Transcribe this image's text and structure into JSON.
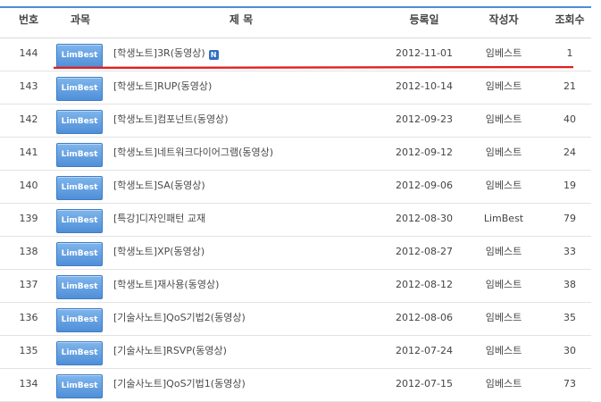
{
  "header": {
    "num": "번호",
    "subject": "과목",
    "title": "제 목",
    "date": "등록일",
    "author": "작성자",
    "views": "조회수"
  },
  "rows": [
    {
      "num": "144",
      "badge": "LimBest",
      "title": "[학생노트]3R(동영상)",
      "is_new": true,
      "new_label": "N",
      "date": "2012-11-01",
      "author": "임베스트",
      "views": "1"
    },
    {
      "num": "143",
      "badge": "LimBest",
      "title": "[학생노트]RUP(동영상)",
      "date": "2012-10-14",
      "author": "임베스트",
      "views": "21"
    },
    {
      "num": "142",
      "badge": "LimBest",
      "title": "[학생노트]컴포넌트(동영상)",
      "date": "2012-09-23",
      "author": "임베스트",
      "views": "40"
    },
    {
      "num": "141",
      "badge": "LimBest",
      "title": "[학생노트]네트워크다이어그램(동영상)",
      "date": "2012-09-12",
      "author": "임베스트",
      "views": "24"
    },
    {
      "num": "140",
      "badge": "LimBest",
      "title": "[학생노트]SA(동영상)",
      "date": "2012-09-06",
      "author": "임베스트",
      "views": "19"
    },
    {
      "num": "139",
      "badge": "LimBest",
      "title": "[특강]디자인패턴 교재",
      "date": "2012-08-30",
      "author": "LimBest",
      "views": "79"
    },
    {
      "num": "138",
      "badge": "LimBest",
      "title": "[학생노트]XP(동영상)",
      "date": "2012-08-27",
      "author": "임베스트",
      "views": "33"
    },
    {
      "num": "137",
      "badge": "LimBest",
      "title": "[학생노트]재사용(동영상)",
      "date": "2012-08-12",
      "author": "임베스트",
      "views": "38"
    },
    {
      "num": "136",
      "badge": "LimBest",
      "title": "[기술사노트]QoS기법2(동영상)",
      "date": "2012-08-06",
      "author": "임베스트",
      "views": "35"
    },
    {
      "num": "135",
      "badge": "LimBest",
      "title": "[기술사노트]RSVP(동영상)",
      "date": "2012-07-24",
      "author": "임베스트",
      "views": "30"
    },
    {
      "num": "134",
      "badge": "LimBest",
      "title": "[기술사노트]QoS기법1(동영상)",
      "date": "2012-07-15",
      "author": "임베스트",
      "views": "73"
    }
  ],
  "colors": {
    "accent": "#4a8fd6",
    "badge": "#5c9ce0",
    "annotation": "#e02020"
  },
  "icons": {
    "new_post": "new-badge-icon"
  }
}
